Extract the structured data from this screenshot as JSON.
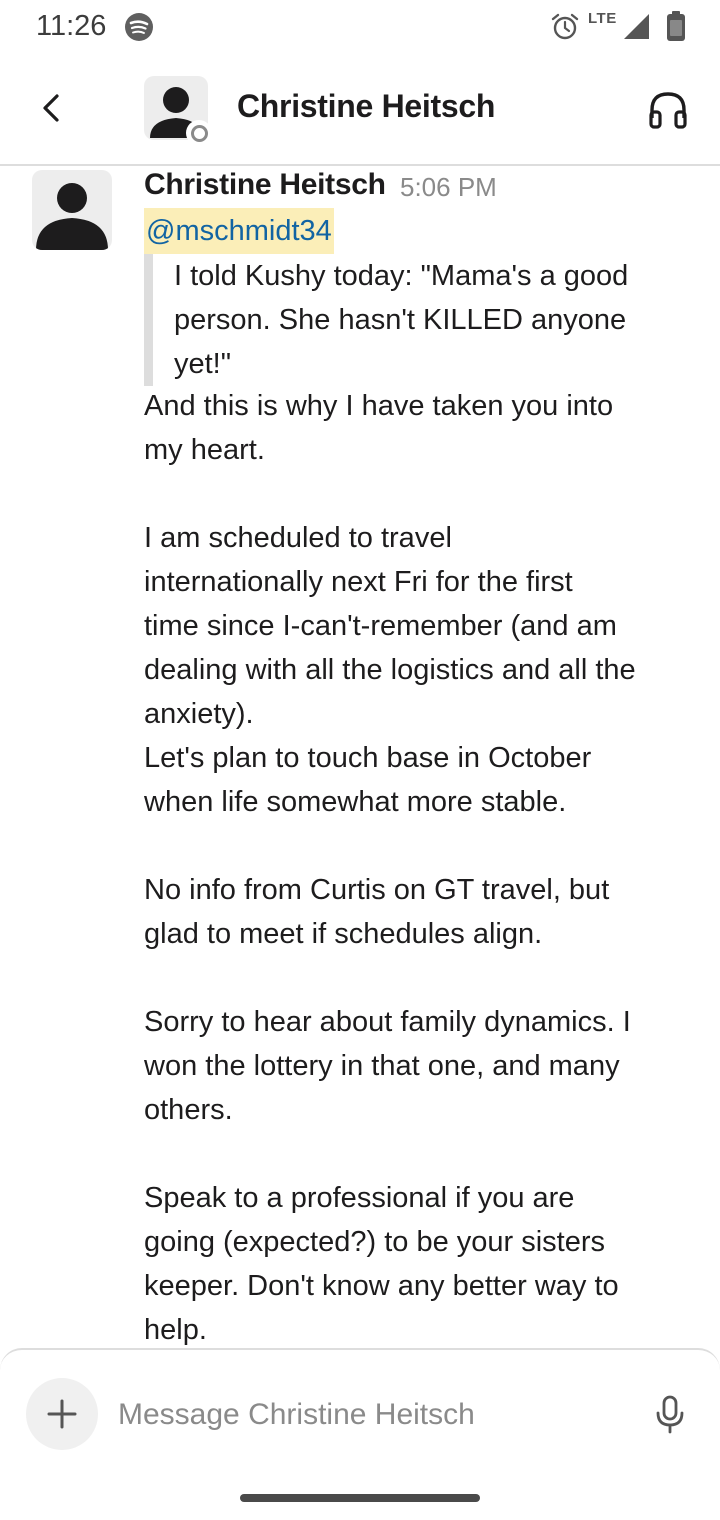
{
  "status_bar": {
    "time": "11:26",
    "network": "LTE",
    "icons": [
      "spotify-icon",
      "alarm-icon",
      "signal-icon",
      "battery-icon"
    ]
  },
  "header": {
    "title": "Christine Heitsch",
    "back_icon": "chevron-left-icon",
    "call_icon": "headphones-icon",
    "presence": "away"
  },
  "message": {
    "author": "Christine Heitsch",
    "time": "5:06 PM",
    "mention": "@mschmidt34",
    "quote_lines": [
      "I told Kushy today: \"Mama's a good",
      "person. She hasn't KILLED anyone",
      "yet!\""
    ],
    "body_lines": [
      "And this is why I have taken you into",
      "my heart.",
      "",
      "I am scheduled to travel",
      "internationally next Fri for the first",
      "time since I-can't-remember (and am",
      "dealing with all the logistics and all the",
      "anxiety).",
      "Let's plan to touch base in October",
      "when life somewhat more stable.",
      "",
      "No info from Curtis on GT travel, but",
      "glad to meet if schedules align.",
      "",
      "Sorry to hear about family dynamics.  I",
      "won the lottery in that one, and many",
      "others.",
      "",
      "Speak to a professional if you are",
      "going (expected?) to be your sisters",
      "keeper.  Don't know any better way to",
      "help."
    ]
  },
  "composer": {
    "placeholder": "Message Christine Heitsch",
    "value": "",
    "add_icon": "plus-icon",
    "mic_icon": "microphone-icon"
  },
  "colors": {
    "mention_bg": "#fbeeb8",
    "mention_text": "#1264a3",
    "text": "#1d1c1d",
    "muted": "#8a8a8a",
    "divider": "#dddddd"
  }
}
